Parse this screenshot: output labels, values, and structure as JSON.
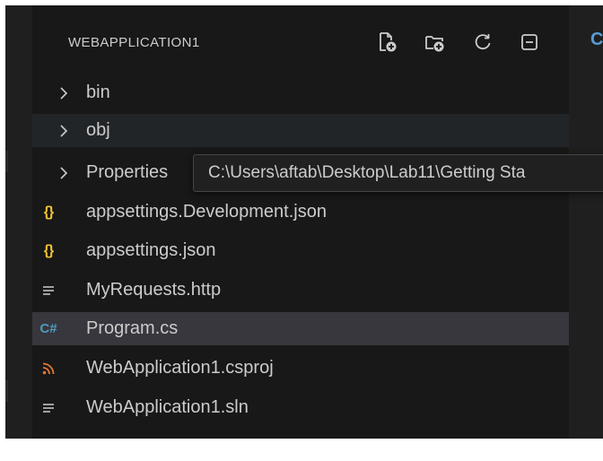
{
  "explorer": {
    "title": "WEBAPPLICATION1",
    "toolbar": [
      {
        "name": "new-file-icon"
      },
      {
        "name": "new-folder-icon"
      },
      {
        "name": "refresh-icon"
      },
      {
        "name": "collapse-all-icon"
      }
    ],
    "items": [
      {
        "label": "bin",
        "kind": "folder",
        "icon": "chevron-right-icon",
        "state": "normal"
      },
      {
        "label": "obj",
        "kind": "folder",
        "icon": "chevron-right-icon",
        "state": "hover"
      },
      {
        "label": "Properties",
        "kind": "folder",
        "icon": "chevron-right-icon",
        "state": "normal"
      },
      {
        "label": "appsettings.Development.json",
        "kind": "file",
        "icon": "json-icon",
        "glyph": "{}",
        "state": "normal"
      },
      {
        "label": "appsettings.json",
        "kind": "file",
        "icon": "json-icon",
        "glyph": "{}",
        "state": "normal"
      },
      {
        "label": "MyRequests.http",
        "kind": "file",
        "icon": "text-file-icon",
        "state": "normal"
      },
      {
        "label": "Program.cs",
        "kind": "file",
        "icon": "csharp-icon",
        "glyph": "C#",
        "state": "selected"
      },
      {
        "label": "WebApplication1.csproj",
        "kind": "file",
        "icon": "rss-icon",
        "state": "normal"
      },
      {
        "label": "WebApplication1.sln",
        "kind": "file",
        "icon": "text-file-icon",
        "state": "normal"
      }
    ]
  },
  "tooltip": {
    "text": "C:\\Users\\aftab\\Desktop\\Lab11\\Getting Sta"
  },
  "editor": {
    "tab_glyph": "C"
  },
  "colors": {
    "background": "#181818",
    "selected_row": "#37373d",
    "hover_row": "#222528",
    "text": "#cccccc",
    "json_icon": "#f1c232",
    "csharp_icon": "#519aba",
    "rss_icon": "#e37933"
  }
}
